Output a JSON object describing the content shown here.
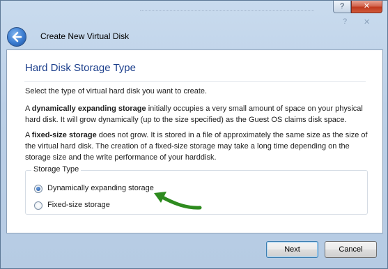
{
  "window": {
    "title": "Create New Virtual Disk",
    "help_glyph": "?",
    "close_glyph": "✕",
    "inner_help_glyph": "?",
    "inner_close_glyph": "✕"
  },
  "page": {
    "title": "Hard Disk Storage Type",
    "intro": "Select the type of virtual hard disk you want to create.",
    "dynamic_desc": {
      "prefix": "A ",
      "bold": "dynamically expanding storage",
      "rest": " initially occupies a very small amount of space on your physical hard disk. It will grow dynamically (up to the size specified) as the Guest OS claims disk space."
    },
    "fixed_desc": {
      "prefix": "A ",
      "bold": "fixed-size storage",
      "rest": " does not grow. It is stored in a file of approximately the same size as the size of the virtual hard disk. The creation of a fixed-size storage may take a long time depending on the storage size and the write performance of your harddisk."
    }
  },
  "storage_type": {
    "legend": "Storage Type",
    "options": [
      {
        "label": "Dynamically expanding storage",
        "selected": true
      },
      {
        "label": "Fixed-size storage",
        "selected": false
      }
    ]
  },
  "buttons": {
    "next": "Next",
    "cancel": "Cancel"
  },
  "annotation": {
    "arrow_color": "#2e8b1f"
  },
  "colors": {
    "title_blue": "#1c3f8c",
    "close_red": "#c0391e"
  }
}
